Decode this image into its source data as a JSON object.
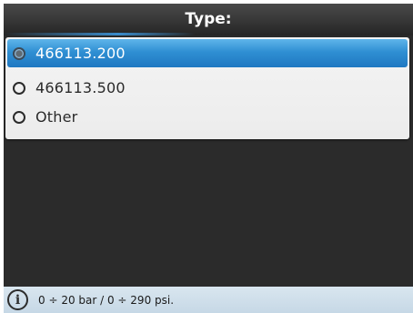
{
  "header": {
    "title": "Type:"
  },
  "options": [
    {
      "label": "466113.200",
      "selected": true
    },
    {
      "label": "466113.500",
      "selected": false
    },
    {
      "label": "Other",
      "selected": false
    }
  ],
  "status": {
    "icon": "info-icon",
    "text": "0 ÷ 20 bar / 0 ÷ 290 psi."
  },
  "colors": {
    "selection": "#2f8fd3",
    "background": "#2b2b2b",
    "statusbar": "#c6d8e6"
  }
}
